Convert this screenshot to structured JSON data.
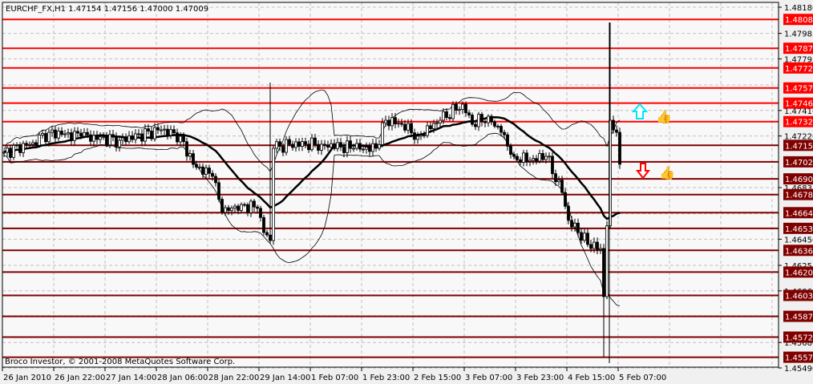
{
  "header": {
    "symbol_line": "EURCHF_FX,H1  1.47154 1.47156 1.47000 1.47009"
  },
  "footer": {
    "copyright": "Broco Investor, © 2001-2008 MetaQuotes Software Corp."
  },
  "colors": {
    "background": "#f8f8f8",
    "level_high": "#ff0000",
    "level_low": "#800000",
    "grid": "#c0c0c0",
    "candle": "#000000",
    "arrow_up": "#00e5ff",
    "arrow_down": "#ff0000"
  },
  "chart_data": {
    "type": "candlestick",
    "title": "EURCHF_FX,H1",
    "ylim": [
      1.4549,
      1.4818
    ],
    "y_ticks": [
      "1.48180",
      "1.47985",
      "1.47795",
      "1.47410",
      "1.47220",
      "1.46835",
      "1.46450",
      "1.46255",
      "1.46065",
      "1.45680",
      "1.45490"
    ],
    "y_tick_values": [
      1.4818,
      1.47985,
      1.47795,
      1.4741,
      1.4722,
      1.46835,
      1.4645,
      1.46255,
      1.46065,
      1.4568,
      1.4549
    ],
    "grid_prices": [
      1.4818,
      1.47985,
      1.47795,
      1.476,
      1.4741,
      1.4722,
      1.4703,
      1.46835,
      1.4664,
      1.4645,
      1.46255,
      1.46065,
      1.4588,
      1.4568,
      1.4549
    ],
    "x_ticks": [
      "26 Jan 2010",
      "26 Jan 22:00",
      "27 Jan 14:00",
      "28 Jan 06:00",
      "28 Jan 22:00",
      "29 Jan 14:00",
      "1 Feb 07:00",
      "1 Feb 23:00",
      "2 Feb 15:00",
      "3 Feb 07:00",
      "3 Feb 23:00",
      "4 Feb 15:00",
      "5 Feb 07:00"
    ],
    "bars_per_tick": 16,
    "close_keypoints": [
      [
        0,
        1.47098
      ],
      [
        9,
        1.4717
      ],
      [
        14,
        1.47247
      ],
      [
        24,
        1.47218
      ],
      [
        36,
        1.47188
      ],
      [
        49,
        1.47265
      ],
      [
        55,
        1.47218
      ],
      [
        59,
        1.47008
      ],
      [
        65,
        1.46919
      ],
      [
        68,
        1.4665
      ],
      [
        74,
        1.46709
      ],
      [
        79,
        1.4668
      ],
      [
        81,
        1.465
      ],
      [
        83,
        1.4644
      ],
      [
        84,
        1.47128
      ],
      [
        89,
        1.47158
      ],
      [
        99,
        1.47158
      ],
      [
        109,
        1.47128
      ],
      [
        116,
        1.47128
      ],
      [
        119,
        1.47337
      ],
      [
        124,
        1.47307
      ],
      [
        129,
        1.47218
      ],
      [
        136,
        1.47337
      ],
      [
        143,
        1.47457
      ],
      [
        146,
        1.47307
      ],
      [
        151,
        1.47367
      ],
      [
        155,
        1.47247
      ],
      [
        159,
        1.47068
      ],
      [
        164,
        1.47038
      ],
      [
        169,
        1.47068
      ],
      [
        174,
        1.46799
      ],
      [
        176,
        1.4659
      ],
      [
        179,
        1.465
      ],
      [
        182,
        1.46411
      ],
      [
        186,
        1.46381
      ],
      [
        187,
        1.46022
      ],
      [
        188,
        1.4655
      ],
      [
        189,
        1.47337
      ],
      [
        191,
        1.47247
      ],
      [
        192,
        1.47009
      ]
    ],
    "spikes": [
      {
        "bar": 83,
        "high": 1.47618
      },
      {
        "bar": 187,
        "low": 1.4557
      },
      {
        "bar": 189,
        "high": 1.48066
      }
    ],
    "indicators": {
      "bollinger_period": 20,
      "bollinger_dev": 2
    },
    "levels": [
      {
        "price": "1.48089",
        "v": 1.48089,
        "color": "#ff0000"
      },
      {
        "price": "1.47874",
        "v": 1.47874,
        "color": "#ff0000"
      },
      {
        "price": "1.47727",
        "v": 1.47727,
        "color": "#ff0000"
      },
      {
        "price": "1.47578",
        "v": 1.47578,
        "color": "#ff0000"
      },
      {
        "price": "1.47465",
        "v": 1.47465,
        "color": "#ff0000"
      },
      {
        "price": "1.47327",
        "v": 1.47327,
        "color": "#ff0000"
      },
      {
        "price": "1.47150",
        "v": 1.4715,
        "color": "#800000"
      },
      {
        "price": "1.47027",
        "v": 1.47027,
        "color": "#800000"
      },
      {
        "price": "1.46900",
        "v": 1.469,
        "color": "#800000"
      },
      {
        "price": "1.46783",
        "v": 1.46783,
        "color": "#800000"
      },
      {
        "price": "1.46648",
        "v": 1.46648,
        "color": "#800000"
      },
      {
        "price": "1.46531",
        "v": 1.46531,
        "color": "#800000"
      },
      {
        "price": "1.46367",
        "v": 1.46367,
        "color": "#800000"
      },
      {
        "price": "1.46205",
        "v": 1.46205,
        "color": "#800000"
      },
      {
        "price": "1.46031",
        "v": 1.46031,
        "color": "#800000"
      },
      {
        "price": "1.45875",
        "v": 1.45875,
        "color": "#800000"
      },
      {
        "price": "1.45720",
        "v": 1.4572,
        "color": "#800000"
      },
      {
        "price": "1.45570",
        "v": 1.4557,
        "color": "#800000"
      }
    ],
    "signals": [
      {
        "type": "buy-arrow",
        "price": 1.474
      },
      {
        "type": "sell-arrow",
        "price": 1.4697
      }
    ]
  }
}
